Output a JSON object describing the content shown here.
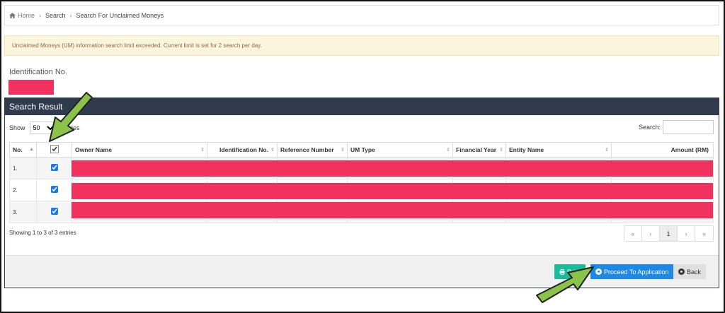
{
  "breadcrumb": {
    "home": "Home",
    "search": "Search",
    "current": "Search For Unclaimed Moneys"
  },
  "alert": {
    "text": "Unclaimed Moneys (UM) information search limit exceeded. Current limit is set for 2 search per day."
  },
  "identification": {
    "label": "Identification No."
  },
  "panel": {
    "title": "Search Result"
  },
  "controls": {
    "show_label": "Show",
    "page_size": "50",
    "entries_label": "entries",
    "search_label": "Search:",
    "search_value": ""
  },
  "table": {
    "headers": [
      "No.",
      "",
      "Owner Name",
      "Identification No.",
      "Reference Number",
      "UM Type",
      "Financial Year",
      "Entity Name",
      "Amount (RM)"
    ],
    "rows": [
      {
        "no": "1.",
        "checked": true
      },
      {
        "no": "2.",
        "checked": true
      },
      {
        "no": "3.",
        "checked": true
      }
    ]
  },
  "footer_info": {
    "showing": "Showing 1 to 3 of 3 entries"
  },
  "pager": {
    "first": "«",
    "prev": "‹",
    "page": "1",
    "next": "›",
    "last": "»"
  },
  "buttons": {
    "print": "Print",
    "proceed": "Proceed To Application",
    "back": "Back"
  },
  "colors": {
    "header": "#2f3b4c",
    "redaction": "#f1325f",
    "alert_bg": "#fcf5dd",
    "print": "#1abc9c",
    "proceed": "#1e88e5",
    "arrow": "#8bc34a"
  }
}
